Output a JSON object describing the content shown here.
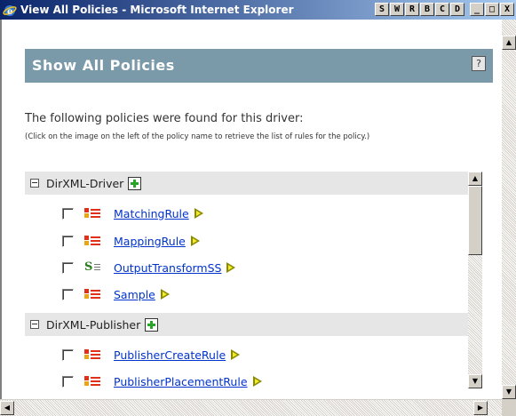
{
  "window": {
    "title": "View All Policies - Microsoft Internet Explorer",
    "toolbar_buttons": [
      "S",
      "W",
      "R",
      "B",
      "C",
      "D"
    ],
    "controls": {
      "minimize": "_",
      "maximize": "□",
      "close": "X"
    }
  },
  "header": {
    "title": "Show All Policies",
    "help_label": "?"
  },
  "intro_text": "The following policies were found for this driver:",
  "note_text": "(Click on the image on the left of the policy name to retrieve the list of rules for the policy.)",
  "groups": [
    {
      "label": "DirXML-Driver",
      "policies": [
        {
          "name": "MatchingRule",
          "type": "rule"
        },
        {
          "name": "MappingRule",
          "type": "rule"
        },
        {
          "name": "OutputTransformSS",
          "type": "stylesheet"
        },
        {
          "name": "Sample",
          "type": "rule"
        }
      ]
    },
    {
      "label": "DirXML-Publisher",
      "policies": [
        {
          "name": "PublisherCreateRule",
          "type": "rule"
        },
        {
          "name": "PublisherPlacementRule",
          "type": "rule"
        }
      ]
    }
  ],
  "icons": {
    "ie": "internet-explorer-icon",
    "add": "add-policy-icon",
    "go": "go-arrow-icon",
    "collapse": "collapse-icon"
  },
  "colors": {
    "header_band": "#7b9aa9",
    "group_row": "#e6e6e6",
    "link": "#0033cc",
    "titlebar_start": "#0a246a",
    "titlebar_end": "#a6caf0"
  }
}
